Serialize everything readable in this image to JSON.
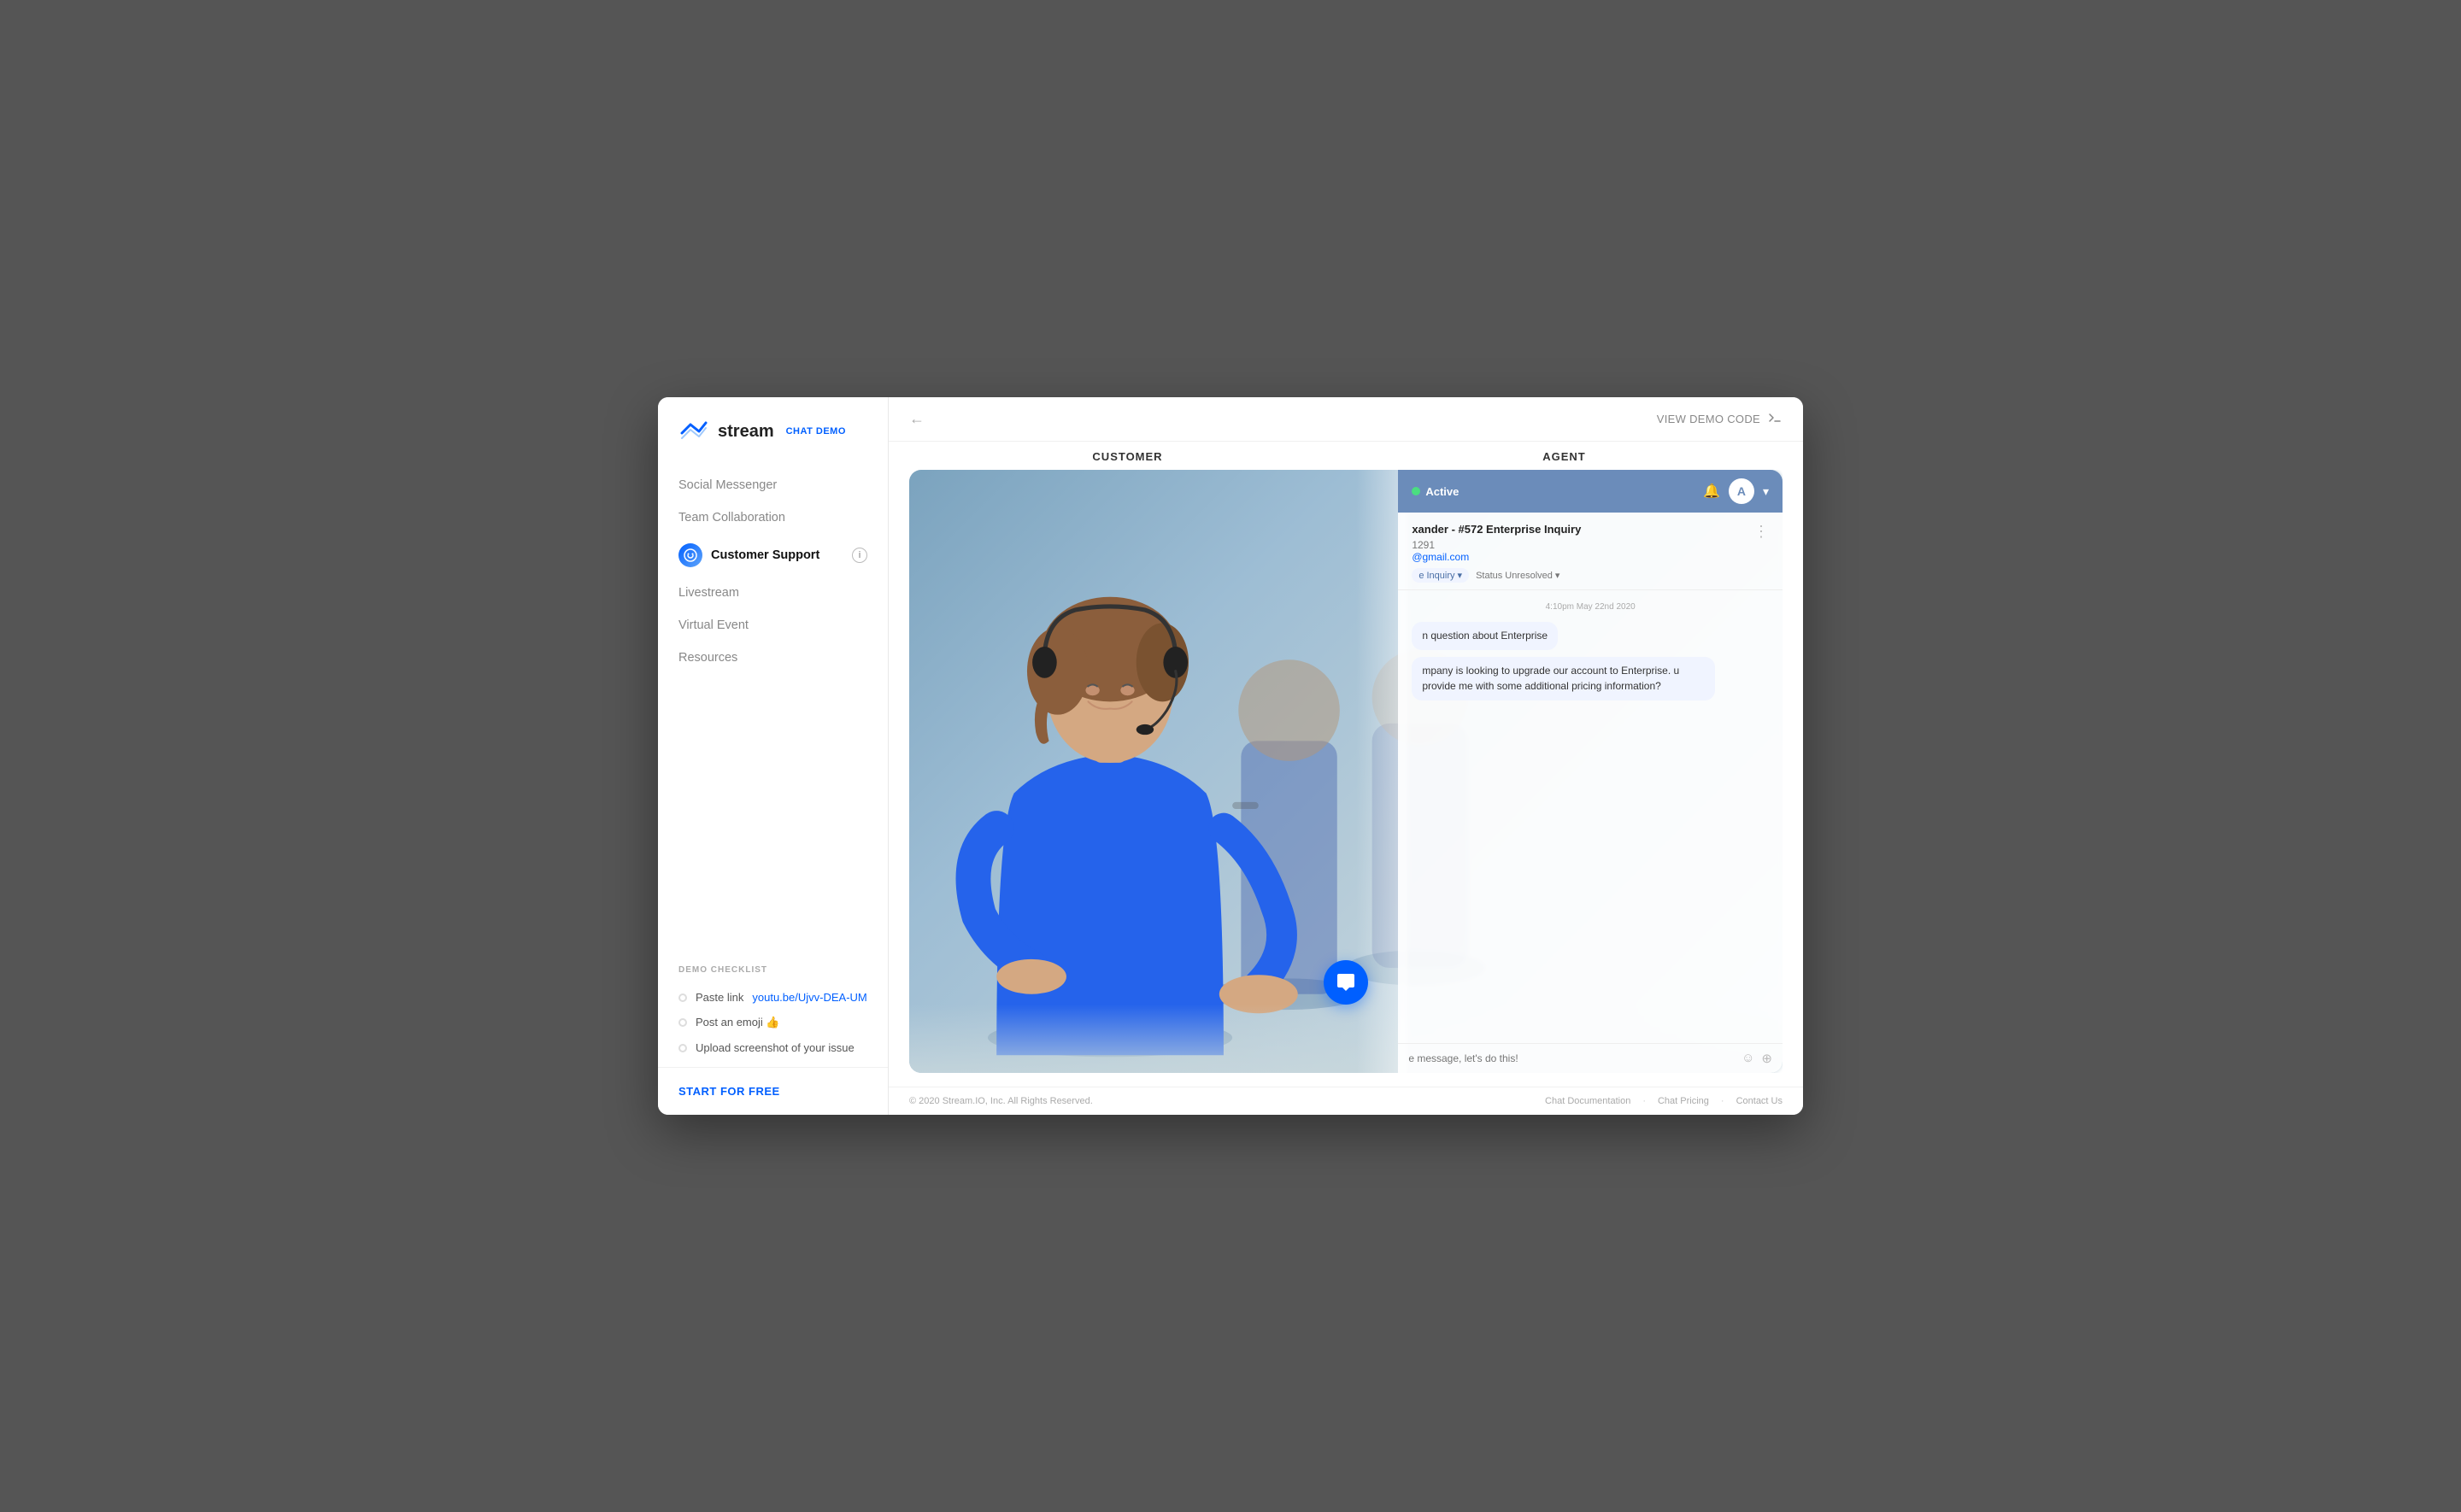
{
  "window": {
    "title": "Stream Chat Demo"
  },
  "sidebar": {
    "logo": {
      "text": "stream",
      "badge": "CHAT DEMO"
    },
    "nav_items": [
      {
        "id": "social-messenger",
        "label": "Social Messenger",
        "active": false
      },
      {
        "id": "team-collaboration",
        "label": "Team Collaboration",
        "active": false
      },
      {
        "id": "customer-support",
        "label": "Customer Support",
        "active": true
      },
      {
        "id": "livestream",
        "label": "Livestream",
        "active": false
      },
      {
        "id": "virtual-event",
        "label": "Virtual Event",
        "active": false
      },
      {
        "id": "resources",
        "label": "Resources",
        "active": false
      }
    ],
    "checklist": {
      "title": "DEMO CHECKLIST",
      "items": [
        {
          "id": "paste-link",
          "label": "Paste link",
          "link_text": "youtu.be/Ujvv-DEA-UM"
        },
        {
          "id": "post-emoji",
          "label": "Post an emoji 👍"
        },
        {
          "id": "upload-screenshot",
          "label": "Upload screenshot of your issue"
        }
      ]
    },
    "footer": {
      "cta": "START FOR FREE"
    }
  },
  "header": {
    "back_icon": "←",
    "view_demo_code": "VIEW DEMO CODE"
  },
  "demo": {
    "customer_label": "CUSTOMER",
    "agent_label": "AGENT"
  },
  "agent_panel": {
    "status": "Active",
    "ticket": {
      "title": "xander - #572 Enterprise Inquiry",
      "id": "1291",
      "email": "@gmail.com",
      "tag": "e Inquiry",
      "status_label": "Status",
      "status_value": "Unresolved"
    },
    "messages": [
      {
        "time": "4:10pm May 22nd 2020",
        "text": "n question about Enterprise"
      },
      {
        "text": "mpany is looking to upgrade our account to Enterprise. u provide me with some additional pricing information?"
      }
    ],
    "input_placeholder": "e message, let's do this!"
  },
  "footer": {
    "copyright": "© 2020 Stream.IO, Inc. All Rights Reserved.",
    "links": [
      {
        "label": "Chat Documentation"
      },
      {
        "label": "Chat Pricing"
      },
      {
        "label": "Contact Us"
      }
    ]
  }
}
